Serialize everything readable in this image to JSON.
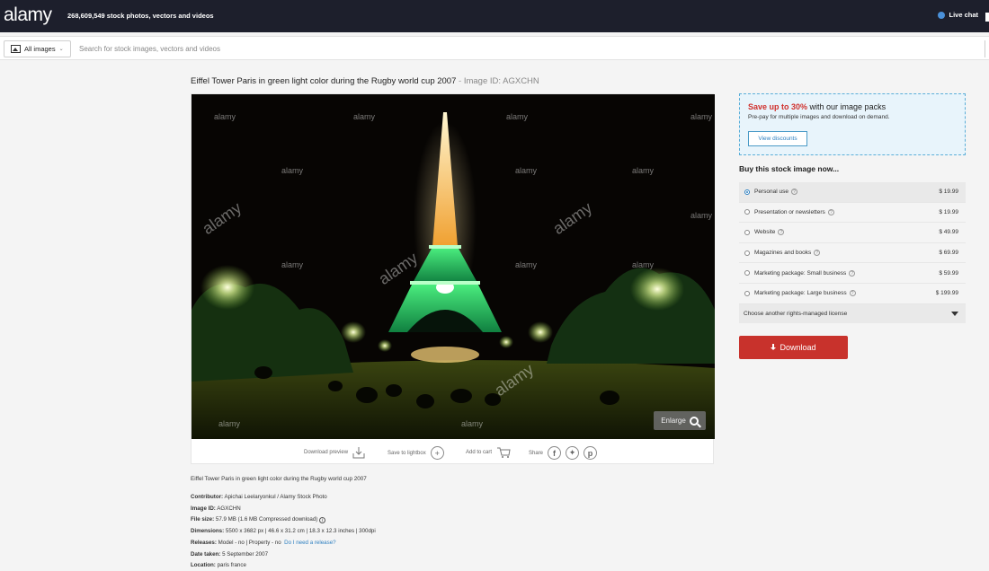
{
  "header": {
    "logo": "alamy",
    "tagline": "268,609,549 stock photos, vectors and videos",
    "live_chat": "Live chat"
  },
  "search": {
    "category": "All images",
    "placeholder": "Search for stock images, vectors and videos"
  },
  "image": {
    "title": "Eiffel Tower Paris in green light color during the Rugby world cup 2007",
    "separator": " - ",
    "image_id_label": "Image ID: AGXCHN",
    "watermark": "alamy",
    "enlarge": "Enlarge"
  },
  "actions": {
    "download_preview": "Download preview",
    "save_to_lightbox": "Save to lightbox",
    "add_to_cart": "Add to cart",
    "share": "Share"
  },
  "details": {
    "caption": "Eiffel Tower Paris in green light color during the Rugby world cup 2007",
    "contributor_label": "Contributor:",
    "contributor": "Apichai Leelaryonkul / Alamy Stock Photo",
    "image_id_label": "Image ID:",
    "image_id": "AGXCHN",
    "file_size_label": "File size:",
    "file_size": "57.9 MB (1.6 MB Compressed download)",
    "dimensions_label": "Dimensions:",
    "dimensions": "5500 x 3682 px | 46.6 x 31.2 cm | 18.3 x 12.3 inches | 300dpi",
    "releases_label": "Releases:",
    "releases": "Model - no | Property - no",
    "release_link": "Do I need a release?",
    "date_taken_label": "Date taken:",
    "date_taken": "5 September 2007",
    "location_label": "Location:",
    "location": "paris france"
  },
  "promo": {
    "highlight": "Save up to 30%",
    "rest": " with our image packs",
    "subtitle": "Pre-pay for multiple images and download on demand.",
    "button": "View discounts"
  },
  "buy": {
    "heading": "Buy this stock image now...",
    "licenses": [
      {
        "label": "Personal use",
        "price": "$ 19.99",
        "selected": true
      },
      {
        "label": "Presentation or newsletters",
        "price": "$ 19.99",
        "selected": false
      },
      {
        "label": "Website",
        "price": "$ 49.99",
        "selected": false
      },
      {
        "label": "Magazines and books",
        "price": "$ 69.99",
        "selected": false
      },
      {
        "label": "Marketing package: Small business",
        "price": "$ 59.99",
        "selected": false
      },
      {
        "label": "Marketing package: Large business",
        "price": "$ 199.99",
        "selected": false
      }
    ],
    "other_license": "Choose another rights-managed license",
    "download": "Download"
  },
  "colors": {
    "topbar": "#1d1f2c",
    "accent_red": "#c8322c",
    "link_blue": "#2d7fc0",
    "promo_bg": "#e8f4fb"
  },
  "icons": [
    "image-icon",
    "chevron-down-icon",
    "chat-icon",
    "search-icon",
    "download-icon",
    "plus-circle-icon",
    "cart-icon",
    "facebook-icon",
    "twitter-icon",
    "pinterest-icon",
    "info-icon",
    "help-icon",
    "triangle-down-icon"
  ]
}
